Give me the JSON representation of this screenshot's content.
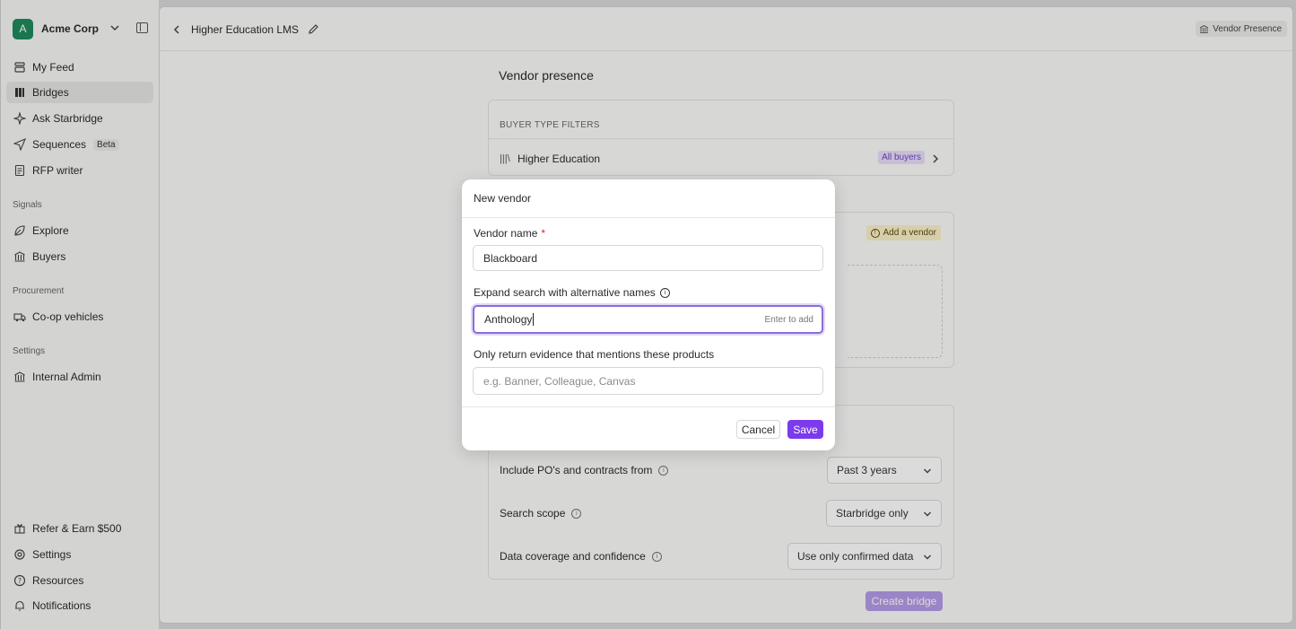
{
  "org": {
    "initial": "A",
    "name": "Acme Corp"
  },
  "nav": {
    "my_feed": "My Feed",
    "bridges": "Bridges",
    "ask": "Ask Starbridge",
    "sequences": "Sequences",
    "beta": "Beta",
    "rfp": "RFP writer",
    "signals_label": "Signals",
    "explore": "Explore",
    "buyers": "Buyers",
    "procurement_label": "Procurement",
    "coop": "Co-op vehicles",
    "settings_label": "Settings",
    "internal_admin": "Internal Admin",
    "refer": "Refer & Earn $500",
    "settings": "Settings",
    "resources": "Resources",
    "notifications": "Notifications"
  },
  "header": {
    "title": "Higher Education LMS",
    "badge": "Vendor Presence"
  },
  "page": {
    "section_title": "Vendor presence",
    "buyer_filters_header": "BUYER TYPE FILTERS",
    "buyer_row_icon": "|||\\",
    "buyer_row": "Higher Education",
    "all_buyers": "All buyers",
    "add_vendor": "Add a vendor",
    "include_label": "Include PO's and contracts from",
    "include_value": "Past 3 years",
    "scope_label": "Search scope",
    "scope_value": "Starbridge only",
    "coverage_label": "Data coverage and confidence",
    "coverage_value": "Use only confirmed data",
    "create_bridge": "Create bridge"
  },
  "modal": {
    "title": "New vendor",
    "vendor_name_label": "Vendor name",
    "required_mark": "*",
    "vendor_name_value": "Blackboard",
    "alt_names_label": "Expand search with alternative names",
    "alt_names_value": "Anthology",
    "alt_names_hint": "Enter to add",
    "products_label": "Only return evidence that mentions these products",
    "products_placeholder": "e.g. Banner, Colleague, Canvas",
    "cancel": "Cancel",
    "save": "Save"
  },
  "colors": {
    "accent": "#7c3aed",
    "org_avatar": "#1f8a5b"
  }
}
